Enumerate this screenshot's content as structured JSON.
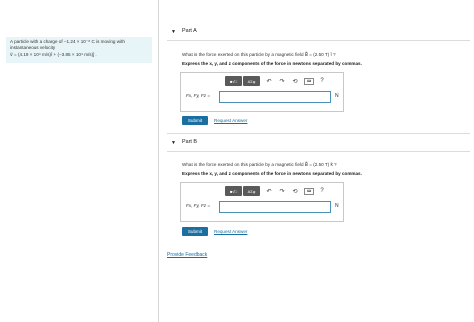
{
  "problem": {
    "lines": [
      "A particle with a charge of −1.24 × 10⁻⁸ C is moving with",
      "instantaneous velocity",
      "v⃗ = (4.19 × 10⁴ m/s)î + (−3.85 × 10⁴ m/s)ĵ ."
    ]
  },
  "parts": [
    {
      "label": "Part A",
      "question": "What is the force exerted on this particle by a magnetic field B⃗ = (2.50 T) î ?",
      "instruction": "Express the x, y, and z components of the force in newtons separated by commas.",
      "eq_label": "Fx, Fy, Fz =",
      "unit": "N",
      "input_value": "",
      "submit_label": "Submit",
      "request_label": "Request Answer"
    },
    {
      "label": "Part B",
      "question": "What is the force exerted on this particle by a magnetic field B⃗ = (2.50 T) k̂ ?",
      "instruction": "Express the x, y, and z components of the force in newtons separated by commas.",
      "eq_label": "Fx, Fy, Fz =",
      "unit": "N",
      "input_value": "",
      "submit_label": "Submit",
      "request_label": "Request Answer"
    }
  ],
  "toolbar": {
    "templates_label": "■√□",
    "symbols_label": "AΣφ",
    "undo_icon": "↶",
    "redo_icon": "↷",
    "reset_icon": "⟲",
    "keyboard_label": "⌨",
    "help_icon": "?"
  },
  "feedback_label": "Provide Feedback"
}
